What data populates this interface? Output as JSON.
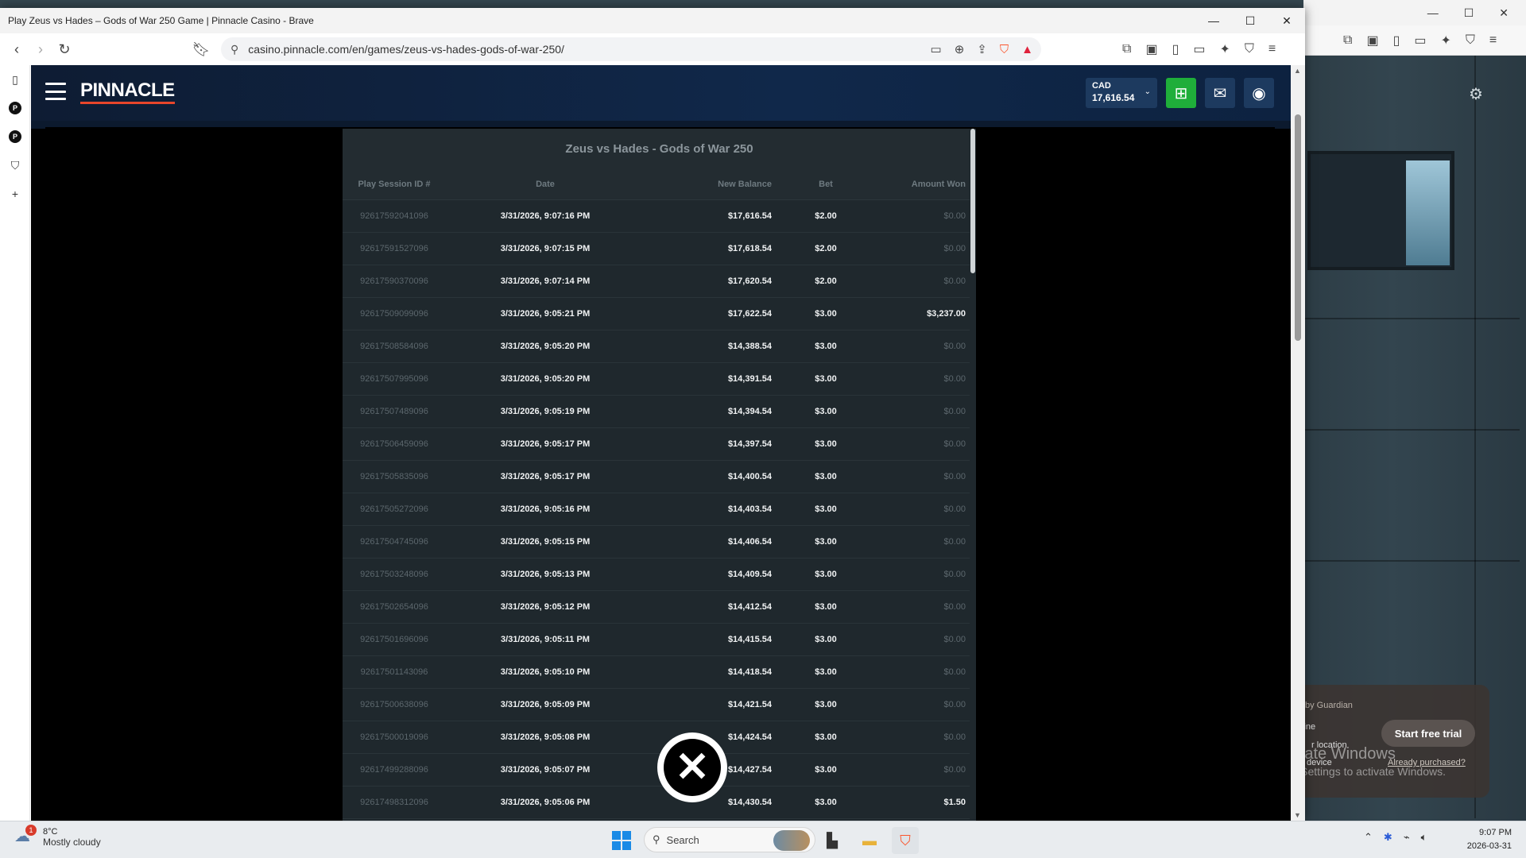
{
  "browser": {
    "window_title": "Play Zeus vs Hades – Gods of War 250 Game | Pinnacle Casino - Brave",
    "url": "casino.pinnacle.com/en/games/zeus-vs-hades-gods-of-war-250/"
  },
  "site": {
    "logo": "PINNACLE",
    "currency": "CAD",
    "balance": "17,616.54"
  },
  "history": {
    "title": "Zeus vs Hades - Gods of War 250",
    "columns": [
      "Play Session ID #",
      "Date",
      "New Balance",
      "Bet",
      "Amount Won"
    ],
    "rows": [
      {
        "id": "92617592041096",
        "date": "3/31/2026, 9:07:16 PM",
        "balance": "$17,616.54",
        "bet": "$2.00",
        "won": "$0.00"
      },
      {
        "id": "92617591527096",
        "date": "3/31/2026, 9:07:15 PM",
        "balance": "$17,618.54",
        "bet": "$2.00",
        "won": "$0.00"
      },
      {
        "id": "92617590370096",
        "date": "3/31/2026, 9:07:14 PM",
        "balance": "$17,620.54",
        "bet": "$2.00",
        "won": "$0.00"
      },
      {
        "id": "92617509099096",
        "date": "3/31/2026, 9:05:21 PM",
        "balance": "$17,622.54",
        "bet": "$3.00",
        "won": "$3,237.00",
        "win": true
      },
      {
        "id": "92617508584096",
        "date": "3/31/2026, 9:05:20 PM",
        "balance": "$14,388.54",
        "bet": "$3.00",
        "won": "$0.00"
      },
      {
        "id": "92617507995096",
        "date": "3/31/2026, 9:05:20 PM",
        "balance": "$14,391.54",
        "bet": "$3.00",
        "won": "$0.00"
      },
      {
        "id": "92617507489096",
        "date": "3/31/2026, 9:05:19 PM",
        "balance": "$14,394.54",
        "bet": "$3.00",
        "won": "$0.00"
      },
      {
        "id": "92617506459096",
        "date": "3/31/2026, 9:05:17 PM",
        "balance": "$14,397.54",
        "bet": "$3.00",
        "won": "$0.00"
      },
      {
        "id": "92617505835096",
        "date": "3/31/2026, 9:05:17 PM",
        "balance": "$14,400.54",
        "bet": "$3.00",
        "won": "$0.00"
      },
      {
        "id": "92617505272096",
        "date": "3/31/2026, 9:05:16 PM",
        "balance": "$14,403.54",
        "bet": "$3.00",
        "won": "$0.00"
      },
      {
        "id": "92617504745096",
        "date": "3/31/2026, 9:05:15 PM",
        "balance": "$14,406.54",
        "bet": "$3.00",
        "won": "$0.00"
      },
      {
        "id": "92617503248096",
        "date": "3/31/2026, 9:05:13 PM",
        "balance": "$14,409.54",
        "bet": "$3.00",
        "won": "$0.00"
      },
      {
        "id": "92617502654096",
        "date": "3/31/2026, 9:05:12 PM",
        "balance": "$14,412.54",
        "bet": "$3.00",
        "won": "$0.00"
      },
      {
        "id": "92617501696096",
        "date": "3/31/2026, 9:05:11 PM",
        "balance": "$14,415.54",
        "bet": "$3.00",
        "won": "$0.00"
      },
      {
        "id": "92617501143096",
        "date": "3/31/2026, 9:05:10 PM",
        "balance": "$14,418.54",
        "bet": "$3.00",
        "won": "$0.00"
      },
      {
        "id": "92617500638096",
        "date": "3/31/2026, 9:05:09 PM",
        "balance": "$14,421.54",
        "bet": "$3.00",
        "won": "$0.00"
      },
      {
        "id": "92617500019096",
        "date": "3/31/2026, 9:05:08 PM",
        "balance": "$14,424.54",
        "bet": "$3.00",
        "won": "$0.00"
      },
      {
        "id": "92617499288096",
        "date": "3/31/2026, 9:05:07 PM",
        "balance": "$14,427.54",
        "bet": "$3.00",
        "won": "$0.00"
      },
      {
        "id": "92617498312096",
        "date": "3/31/2026, 9:05:06 PM",
        "balance": "$14,430.54",
        "bet": "$3.00",
        "won": "$1.50",
        "win": true
      }
    ]
  },
  "guardian": {
    "brand": "by Guardian",
    "line1": "line",
    "line2": "r location",
    "line3": "device",
    "trial_button": "Start free trial",
    "purchased_link": "Already purchased?"
  },
  "activate": {
    "line1": "Activate Windows",
    "line2": "Go to Settings to activate Windows."
  },
  "taskbar": {
    "weather_badge": "1",
    "temperature": "8°C",
    "condition": "Mostly cloudy",
    "search_placeholder": "Search",
    "time": "9:07 PM",
    "date": "2026-03-31"
  },
  "colors": {
    "deposit": "#1fae3a",
    "header": "#10284a",
    "logo_accent": "#e8462b"
  }
}
